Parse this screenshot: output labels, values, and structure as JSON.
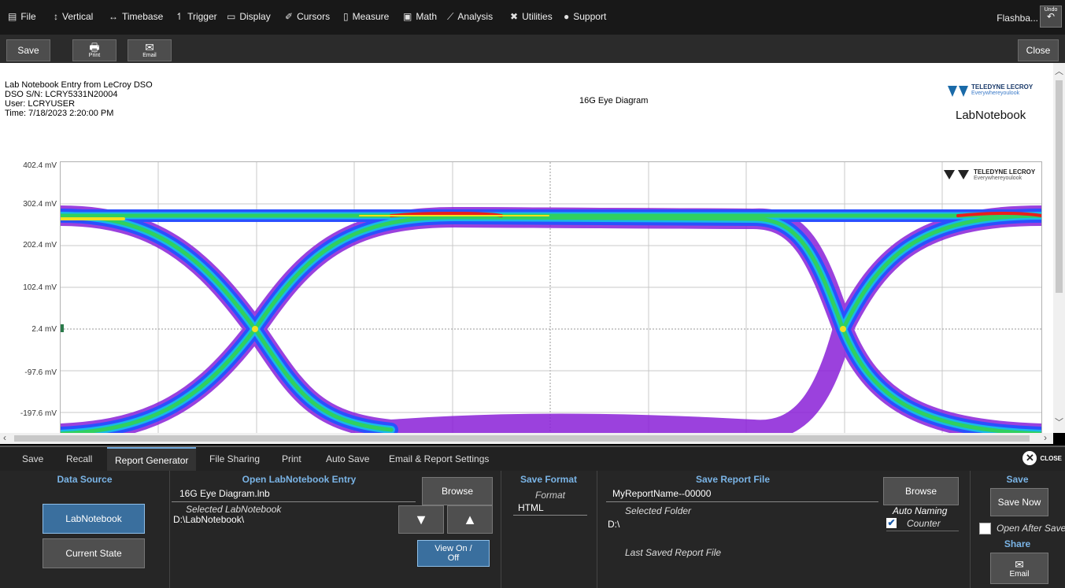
{
  "menubar": {
    "items": [
      {
        "label": "File",
        "icon": "file-icon"
      },
      {
        "label": "Vertical",
        "icon": "vertical-icon"
      },
      {
        "label": "Timebase",
        "icon": "timebase-icon"
      },
      {
        "label": "Trigger",
        "icon": "trigger-icon"
      },
      {
        "label": "Display",
        "icon": "display-icon"
      },
      {
        "label": "Cursors",
        "icon": "cursors-icon"
      },
      {
        "label": "Measure",
        "icon": "measure-icon"
      },
      {
        "label": "Math",
        "icon": "math-icon"
      },
      {
        "label": "Analysis",
        "icon": "analysis-icon"
      },
      {
        "label": "Utilities",
        "icon": "utilities-icon"
      },
      {
        "label": "Support",
        "icon": "support-icon"
      }
    ],
    "flashback": "Flashba...",
    "undo": "Undo"
  },
  "toolbar": {
    "save": "Save",
    "print_icon": "print-icon",
    "print_label": "Print",
    "email_icon": "email-icon",
    "email_label": "Email",
    "close": "Close"
  },
  "report": {
    "line1": "Lab Notebook Entry from LeCroy DSO",
    "line2": "DSO S/N: LCRY5331N20004",
    "line3": "User: LCRYUSER",
    "line4": "Time: 7/18/2023 2:20:00 PM",
    "title": "16G Eye Diagram",
    "brand": "TELEDYNE LECROY",
    "tagline": "Everywhereyoulook",
    "notebook": "LabNotebook"
  },
  "plot": {
    "ylabels": [
      "402.4 mV",
      "302.4 mV",
      "202.4 mV",
      "102.4 mV",
      "2.4 mV",
      "-97.6 mV",
      "-197.6 mV"
    ],
    "watermark_brand": "TELEDYNE LECROY",
    "watermark_tagline": "Everywhereyoulook",
    "colors": {
      "hot": "#e8201c",
      "warm": "#f0e020",
      "mid": "#30d060",
      "cool": "#20a0e8",
      "cold": "#3040ff",
      "edge": "#a020e0"
    }
  },
  "tabs": [
    "Save",
    "Recall",
    "Report Generator",
    "File Sharing",
    "Print",
    "Auto Save",
    "Email & Report Settings"
  ],
  "active_tab": "Report Generator",
  "panel": {
    "close_label": "CLOSE",
    "data_source": {
      "title": "Data Source",
      "labnotebook": "LabNotebook",
      "current_state": "Current State"
    },
    "open_entry": {
      "title": "Open LabNotebook Entry",
      "file": "16G Eye Diagram.lnb",
      "selected_label": "Selected LabNotebook",
      "selected_path": "D:\\LabNotebook\\",
      "browse": "Browse",
      "view": "View On / Off"
    },
    "save_format": {
      "title": "Save Format",
      "format_label": "Format",
      "format_value": "HTML"
    },
    "save_report": {
      "title": "Save Report File",
      "filename": "MyReportName--00000",
      "selected_folder_label": "Selected Folder",
      "folder": "D:\\",
      "last_saved_label": "Last Saved Report File",
      "browse": "Browse",
      "auto_naming": "Auto Naming",
      "counter": "Counter"
    },
    "save": {
      "title": "Save",
      "save_now": "Save Now",
      "open_after": "Open After Save",
      "share_title": "Share",
      "email_label": "Email"
    }
  }
}
